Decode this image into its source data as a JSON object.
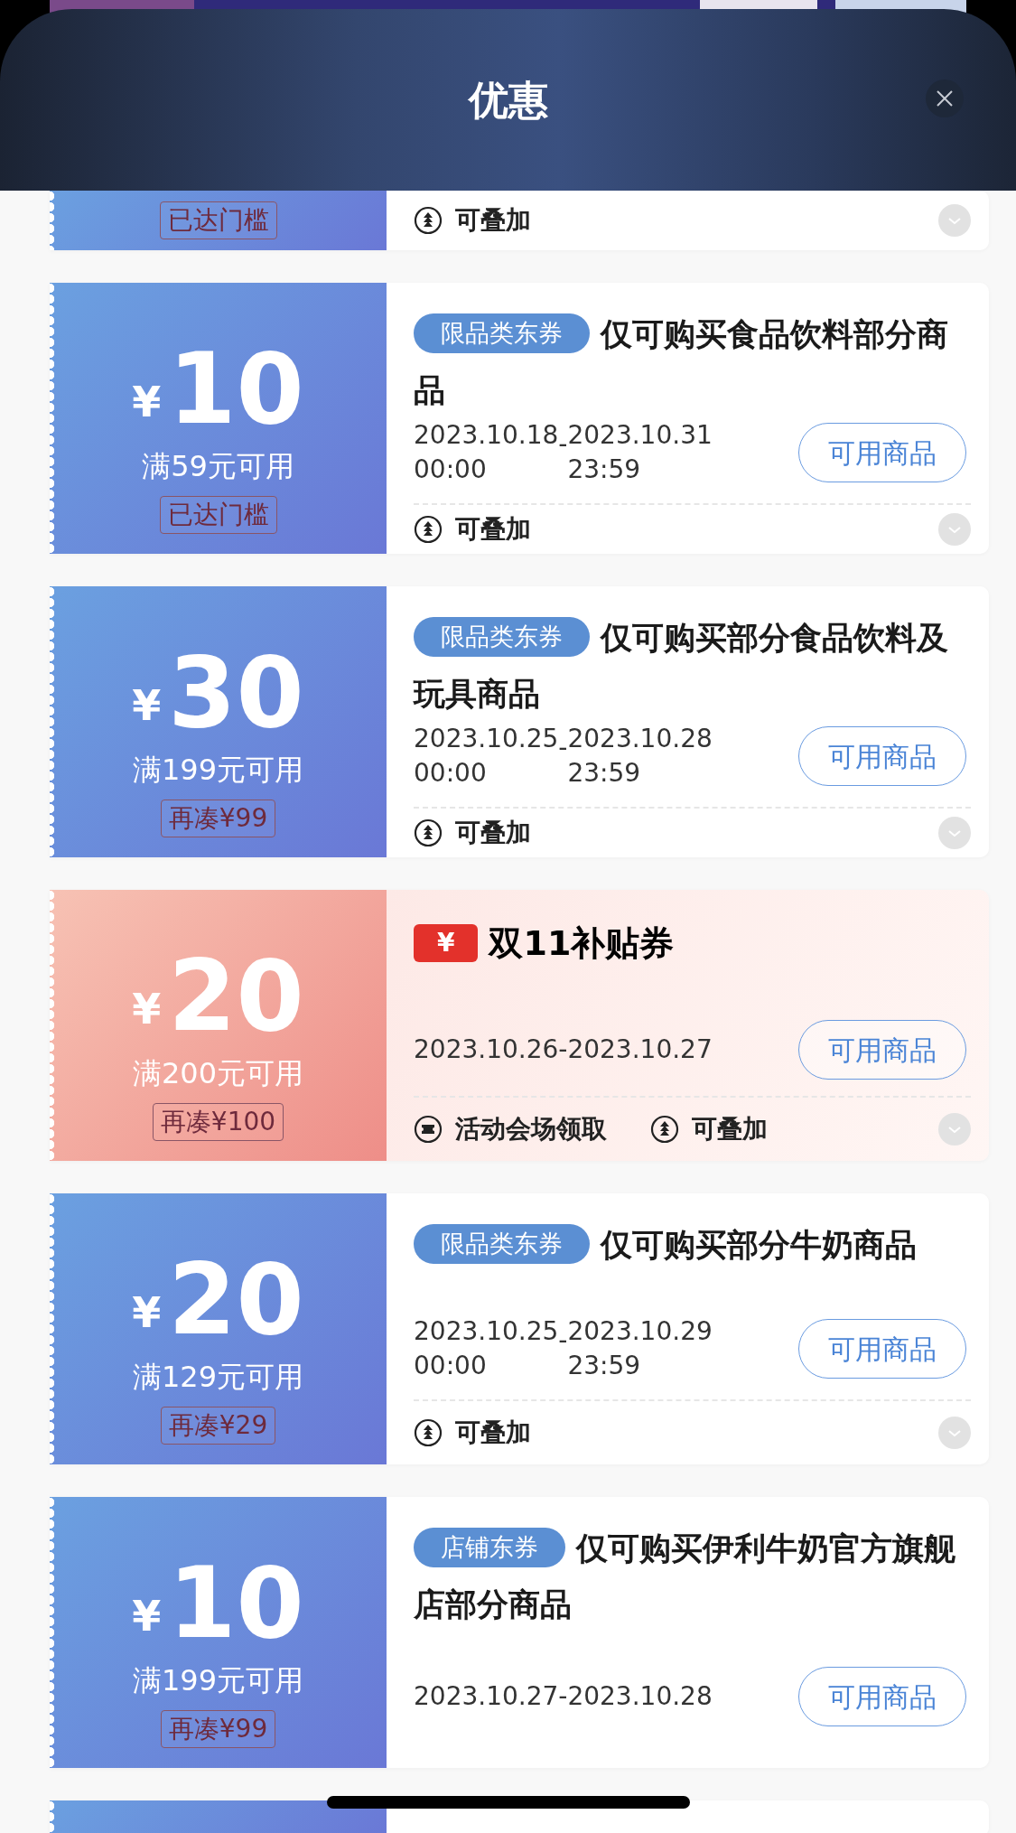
{
  "sheet": {
    "title": "优惠"
  },
  "coupons": [
    {
      "kind": "blue",
      "threshold": "已达门槛",
      "features": [
        {
          "kind": "stack",
          "label": "可叠加"
        }
      ]
    },
    {
      "kind": "blue",
      "currency": "¥",
      "amount": "10",
      "condition": "满59元可用",
      "threshold": "已达门槛",
      "tag": {
        "kind": "pill",
        "label": "限品类东券"
      },
      "title": "仅可购买食品饮料部分商品",
      "date": {
        "kind": "split",
        "start": "2023.10.18",
        "start_time": "00:00",
        "separator": "-",
        "end": "2023.10.31",
        "end_time": "23:59"
      },
      "button": "可用商品",
      "features": [
        {
          "kind": "stack",
          "label": "可叠加"
        }
      ]
    },
    {
      "kind": "blue",
      "currency": "¥",
      "amount": "30",
      "condition": "满199元可用",
      "threshold": "再凑¥99",
      "tag": {
        "kind": "pill",
        "label": "限品类东券"
      },
      "title": "仅可购买部分食品饮料及玩具商品",
      "date": {
        "kind": "split",
        "start": "2023.10.25",
        "start_time": "00:00",
        "separator": "-",
        "end": "2023.10.28",
        "end_time": "23:59"
      },
      "button": "可用商品",
      "features": [
        {
          "kind": "stack",
          "label": "可叠加"
        }
      ]
    },
    {
      "kind": "festive",
      "currency": "¥",
      "amount": "20",
      "condition": "满200元可用",
      "threshold": "再凑¥100",
      "tag": {
        "kind": "logo",
        "mark": "¥",
        "label": "双11补贴券"
      },
      "date": {
        "kind": "single",
        "text": "2023.10.26-2023.10.27"
      },
      "button": "可用商品",
      "features": [
        {
          "kind": "ticket",
          "label": "活动会场领取"
        },
        {
          "kind": "stack",
          "label": "可叠加"
        }
      ]
    },
    {
      "kind": "blue",
      "currency": "¥",
      "amount": "20",
      "condition": "满129元可用",
      "threshold": "再凑¥29",
      "tag": {
        "kind": "pill",
        "label": "限品类东券"
      },
      "title": "仅可购买部分牛奶商品",
      "date": {
        "kind": "split",
        "start": "2023.10.25",
        "start_time": "00:00",
        "separator": "-",
        "end": "2023.10.29",
        "end_time": "23:59"
      },
      "button": "可用商品",
      "features": [
        {
          "kind": "stack",
          "label": "可叠加"
        }
      ]
    },
    {
      "kind": "blue",
      "currency": "¥",
      "amount": "10",
      "condition": "满199元可用",
      "threshold": "再凑¥99",
      "tag": {
        "kind": "pill",
        "label": "店铺东券"
      },
      "title": "仅可购买伊利牛奶官方旗舰店部分商品",
      "date": {
        "kind": "single",
        "text": "2023.10.27-2023.10.28"
      },
      "button": "可用商品"
    },
    {
      "kind": "blue"
    }
  ]
}
